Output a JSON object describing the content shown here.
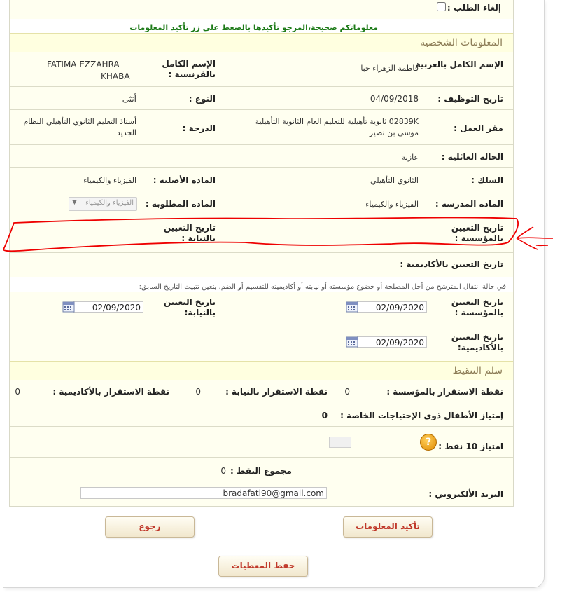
{
  "cancel_label": "إلغاء الطلب :",
  "notice": "معلوماتكم صحيحة،المرجو تأكيدها بالضغط على زر تأكيد المعلومات",
  "personal_section_title": "المعلومات الشخصية",
  "fields": {
    "name_ar_label": "الإسم الكامل بالعربية",
    "name_ar_value": "فاطمة الزهراء خبا",
    "name_fr_label_1": "الإسم الكامل",
    "name_fr_label_2": "بالفرنسية :",
    "name_fr_value_1": "FATIMA EZZAHRA",
    "name_fr_value_2": "KHABA",
    "hire_date_label": "تاريخ التوظيف :",
    "hire_date_value": "04/09/2018",
    "gender_label": "النوع :",
    "gender_value": "أنثى",
    "workplace_label": "مقر العمل :",
    "workplace_value_1": "02839K ثانوية تأهيلية للتعليم العام الثانوية التأهيلية",
    "workplace_value_2": "موسى بن نصير",
    "grade_label": "الدرجة :",
    "grade_value_1": "أستاذ التعليم الثانوي التأهيلي النظام",
    "grade_value_2": "الجديد",
    "marital_label": "الحالة العائلية :",
    "marital_value": "عازبة",
    "corps_label": "السلك :",
    "corps_value": "الثانوي التأهيلي",
    "orig_subject_label": "المادة الأصلية :",
    "orig_subject_value": "الفيزياء والكيمياء",
    "taught_subject_label": "المادة المدرسة :",
    "taught_subject_value": "الفيزياء والكيمياء",
    "req_subject_label": "المادة المطلوبة :",
    "req_subject_value": "الفيزياء والكيمياء",
    "appt_inst_label_1": "تاريخ التعيين",
    "appt_inst_label_2": "بالمؤسسة :",
    "appt_prov_label_1": "تاريخ التعيين",
    "appt_prov_label_2": "بالنيابة :",
    "appt_acad_label": "تاريخ التعيين بالأكاديمية :"
  },
  "transfer_note": "في حالة انتقال المترشح من أجل المصلحة أو خضوع مؤسسته أو نيابته أو أكاديميته للتقسيم أو الضم، يتعين تثبيت التاريخ السابق:",
  "prior": {
    "inst_label_1": "تاريخ التعيين",
    "inst_label_2": "بالمؤسسة :",
    "inst_date": "02/09/2020",
    "prov_label_1": "تاريخ التعيين",
    "prov_label_2": "بالنيابة:",
    "prov_date": "02/09/2020",
    "acad_label_1": "تاريخ التعيين",
    "acad_label_2": "بالأكاديمية:",
    "acad_date": "02/09/2020"
  },
  "scoring_section_title": "سلم التنقيط",
  "scores": {
    "stab_inst_label": "نقطة الاستقرار بالمؤسسة :",
    "stab_inst_value": "0",
    "stab_prov_label": "نقطة الاستقرار بالنيابة :",
    "stab_prov_value": "0",
    "stab_acad_label": "نقطة الاستقرار بالأكاديمية :",
    "stab_acad_value": "0",
    "special_needs_label": "إمتياز الأطفال ذوي الإحتياجات الخاصة :",
    "special_needs_value": "0",
    "bonus_label": "امتياز 10 نقط :",
    "total_label": "مجموع النقط :",
    "total_value": "0"
  },
  "email_label": "البريد الألكتروني :",
  "email_value": "bradafati90@gmail.com",
  "buttons": {
    "confirm": "تأكيد المعلومات",
    "back": "رجوع",
    "save": "حفظ المعطيات"
  }
}
